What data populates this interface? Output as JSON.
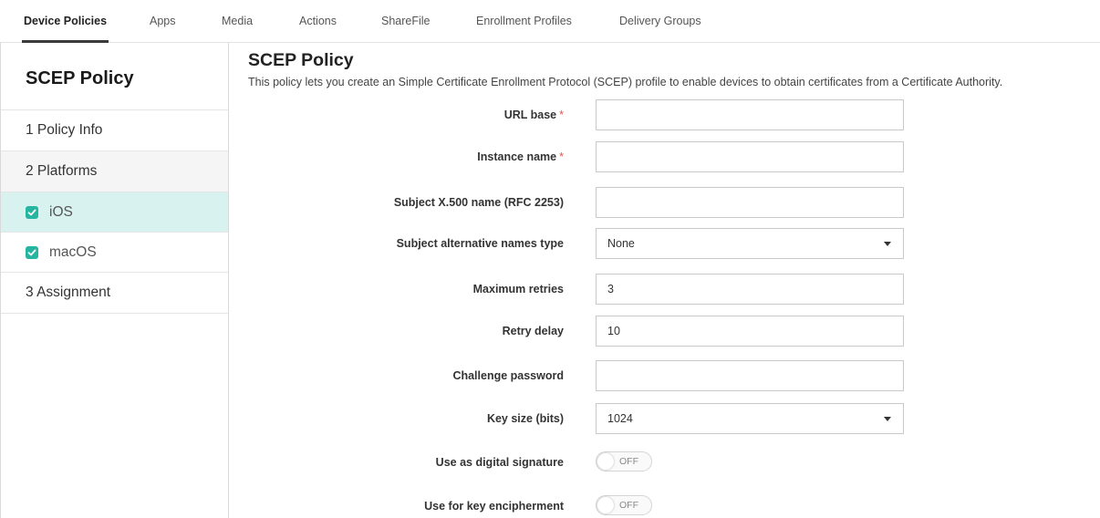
{
  "topnav": {
    "tabs": [
      {
        "label": "Device Policies",
        "active": true
      },
      {
        "label": "Apps"
      },
      {
        "label": "Media"
      },
      {
        "label": "Actions"
      },
      {
        "label": "ShareFile"
      },
      {
        "label": "Enrollment Profiles"
      },
      {
        "label": "Delivery Groups"
      }
    ]
  },
  "sidebar": {
    "title": "SCEP Policy",
    "items": [
      {
        "label": "1  Policy Info"
      },
      {
        "label": "2  Platforms"
      },
      {
        "label": "iOS",
        "checked": true,
        "selected": true
      },
      {
        "label": "macOS",
        "checked": true
      },
      {
        "label": "3  Assignment"
      }
    ]
  },
  "main": {
    "title": "SCEP Policy",
    "description": "This policy lets you create an Simple Certificate Enrollment Protocol (SCEP) profile to enable devices to obtain certificates from a Certificate Authority.",
    "fields": {
      "url_base": {
        "label": "URL base",
        "required": "*",
        "value": ""
      },
      "instance_name": {
        "label": "Instance name",
        "required": "*",
        "value": ""
      },
      "subject_x500": {
        "label": "Subject X.500 name (RFC 2253)",
        "value": ""
      },
      "subject_alt_type": {
        "label": "Subject alternative names type",
        "value": "None"
      },
      "max_retries": {
        "label": "Maximum retries",
        "value": "3"
      },
      "retry_delay": {
        "label": "Retry delay",
        "value": "10"
      },
      "challenge_password": {
        "label": "Challenge password",
        "value": ""
      },
      "key_size": {
        "label": "Key size (bits)",
        "value": "1024"
      },
      "digital_signature": {
        "label": "Use as digital signature",
        "state": "OFF"
      },
      "key_encipherment": {
        "label": "Use for key encipherment",
        "state": "OFF"
      }
    }
  },
  "colors": {
    "accent": "#25b5a1",
    "selected_bg": "#d7f2ef",
    "required": "#e0564f"
  },
  "icons": {
    "checkbox": "check-icon",
    "dropdown": "caret-down-icon"
  }
}
